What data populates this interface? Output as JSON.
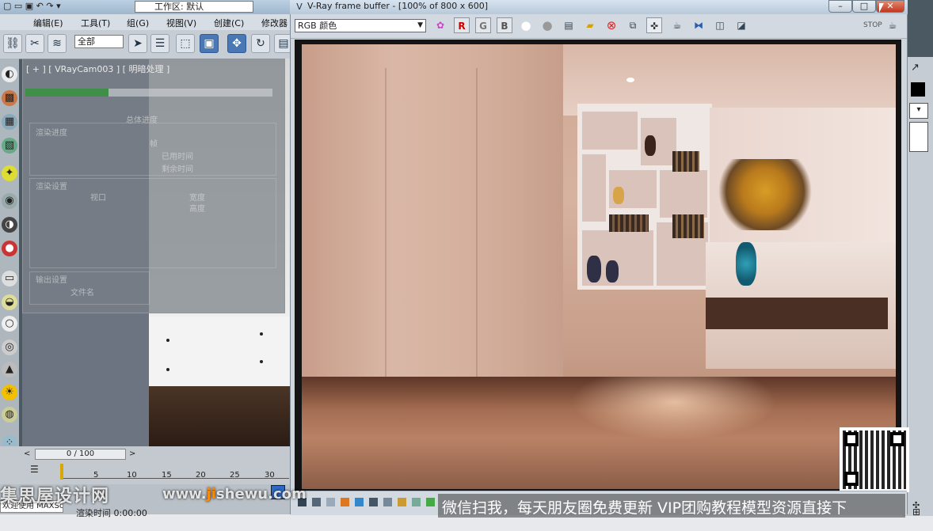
{
  "max": {
    "workspace_label": "工作区: 默认",
    "menu": [
      "编辑(E)",
      "工具(T)",
      "组(G)",
      "视图(V)",
      "创建(C)",
      "修改器"
    ],
    "filter_select": "全部",
    "viewport_label": "[ + ] [ VRayCam003 ] [ 明暗处理 ]",
    "dialog_texts": [
      "总体进度",
      "渲染进度",
      "帧",
      "已用时间",
      "剩余时间",
      "渲染设置",
      "视口",
      "宽度",
      "高度",
      "输出设置",
      "文件名"
    ],
    "frame_counter": "0 / 100",
    "timeline_ticks": [
      "5",
      "10",
      "15",
      "20",
      "25",
      "30"
    ],
    "welcome_text": "欢迎使用 MAXSc",
    "render_time_label": "渲染时间",
    "render_time_value": "0:00:00"
  },
  "vfb": {
    "title": "V-Ray frame buffer - [100% of 800 x 600]",
    "channel_select": "RGB 颜色",
    "rgb_buttons": [
      "R",
      "G",
      "B"
    ]
  },
  "overlay": {
    "watermark_brand": "集思屋设计网",
    "watermark_url_prefix": "www.",
    "watermark_url_accent": "ji",
    "watermark_url_suffix": "shewu.com",
    "promo_text": "微信扫我，每天朋友圈免费更新 VIP团购教程模型资源直接下"
  },
  "colors": {
    "accent_blue": "#4a78b5",
    "close_red": "#c0381f",
    "progress_green": "#3f8f48",
    "watermark_orange": "#ff8a00"
  }
}
